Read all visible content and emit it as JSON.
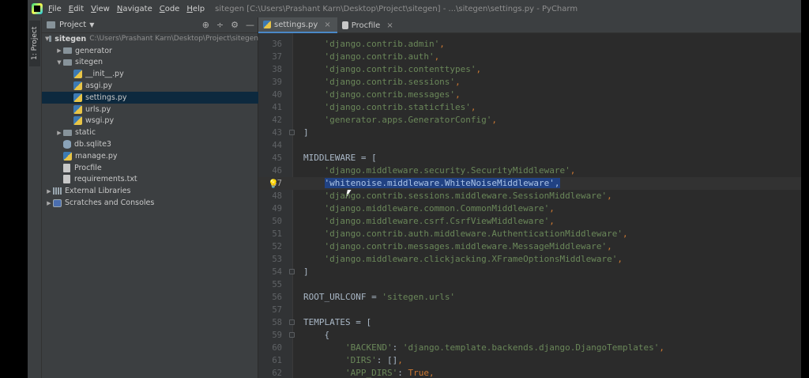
{
  "window_title": "sitegen [C:\\Users\\Prashant Karn\\Desktop\\Project\\sitegen] - ...\\sitegen\\settings.py - PyCharm",
  "menu": [
    {
      "pre": "",
      "u": "F",
      "post": "ile"
    },
    {
      "pre": "",
      "u": "E",
      "post": "dit"
    },
    {
      "pre": "",
      "u": "V",
      "post": "iew"
    },
    {
      "pre": "",
      "u": "N",
      "post": "avigate"
    },
    {
      "pre": "",
      "u": "C",
      "post": "ode"
    },
    {
      "pre": "",
      "u": "H",
      "post": "elp"
    }
  ],
  "tool_stripe": {
    "project_tab": "1: Project"
  },
  "project_panel": {
    "title": "Project",
    "tools": [
      "⊕",
      "÷",
      "⚙",
      "—"
    ]
  },
  "tree": [
    {
      "indent": 0,
      "arrow": "▼",
      "icon": "folder",
      "label": "sitegen",
      "bold": true,
      "path": "C:\\Users\\Prashant Karn\\Desktop\\Project\\sitegen"
    },
    {
      "indent": 1,
      "arrow": "▶",
      "icon": "folder",
      "label": "generator"
    },
    {
      "indent": 1,
      "arrow": "▼",
      "icon": "folder",
      "label": "sitegen"
    },
    {
      "indent": 2,
      "arrow": "",
      "icon": "py",
      "label": "__init__.py"
    },
    {
      "indent": 2,
      "arrow": "",
      "icon": "py",
      "label": "asgi.py"
    },
    {
      "indent": 2,
      "arrow": "",
      "icon": "py",
      "label": "settings.py",
      "selected": true
    },
    {
      "indent": 2,
      "arrow": "",
      "icon": "py",
      "label": "urls.py"
    },
    {
      "indent": 2,
      "arrow": "",
      "icon": "py",
      "label": "wsgi.py"
    },
    {
      "indent": 1,
      "arrow": "▶",
      "icon": "folder",
      "label": "static"
    },
    {
      "indent": 1,
      "arrow": "",
      "icon": "db",
      "label": "db.sqlite3"
    },
    {
      "indent": 1,
      "arrow": "",
      "icon": "py",
      "label": "manage.py"
    },
    {
      "indent": 1,
      "arrow": "",
      "icon": "file",
      "label": "Procfile"
    },
    {
      "indent": 1,
      "arrow": "",
      "icon": "file",
      "label": "requirements.txt"
    },
    {
      "indent": 0,
      "arrow": "▶",
      "icon": "lib",
      "label": "External Libraries"
    },
    {
      "indent": 0,
      "arrow": "▶",
      "icon": "scratch",
      "label": "Scratches and Consoles"
    }
  ],
  "tabs": [
    {
      "label": "settings.py",
      "icon": "py",
      "active": true
    },
    {
      "label": "Procfile",
      "icon": "file",
      "active": false
    }
  ],
  "code_lines": [
    {
      "n": "36",
      "t": [
        [
          "s-str",
          "    'django.contrib.admin'"
        ],
        [
          "s-kw",
          ","
        ]
      ]
    },
    {
      "n": "37",
      "t": [
        [
          "s-str",
          "    'django.contrib.auth'"
        ],
        [
          "s-kw",
          ","
        ]
      ]
    },
    {
      "n": "38",
      "t": [
        [
          "s-str",
          "    'django.contrib.contenttypes'"
        ],
        [
          "s-kw",
          ","
        ]
      ]
    },
    {
      "n": "39",
      "t": [
        [
          "s-str",
          "    'django.contrib.sessions'"
        ],
        [
          "s-kw",
          ","
        ]
      ]
    },
    {
      "n": "40",
      "t": [
        [
          "s-str",
          "    'django.contrib.messages'"
        ],
        [
          "s-kw",
          ","
        ]
      ]
    },
    {
      "n": "41",
      "t": [
        [
          "s-str",
          "    'django.contrib.staticfiles'"
        ],
        [
          "s-kw",
          ","
        ]
      ]
    },
    {
      "n": "42",
      "t": [
        [
          "s-str",
          "    'generator.apps.GeneratorConfig'"
        ],
        [
          "s-kw",
          ","
        ]
      ]
    },
    {
      "n": "43",
      "t": [
        [
          "s-id",
          "]"
        ]
      ],
      "fold": true
    },
    {
      "n": "44",
      "t": []
    },
    {
      "n": "45",
      "t": [
        [
          "s-id",
          "MIDDLEWARE = ["
        ]
      ]
    },
    {
      "n": "46",
      "t": [
        [
          "s-str",
          "    'django.middleware.security.SecurityMiddleware'"
        ],
        [
          "s-kw",
          ","
        ]
      ]
    },
    {
      "n": "47",
      "t": [
        [
          "s-id",
          "    "
        ],
        [
          "s-sel",
          "'whitenoise.middleware.WhiteNoiseMiddleware',"
        ]
      ],
      "current": true,
      "bulb": true
    },
    {
      "n": "48",
      "t": [
        [
          "s-str",
          "    'django.contrib.sessions.middleware.SessionMiddleware'"
        ],
        [
          "s-kw",
          ","
        ]
      ]
    },
    {
      "n": "49",
      "t": [
        [
          "s-str",
          "    'django.middleware.common.CommonMiddleware'"
        ],
        [
          "s-kw",
          ","
        ]
      ]
    },
    {
      "n": "50",
      "t": [
        [
          "s-str",
          "    'django.middleware.csrf.CsrfViewMiddleware'"
        ],
        [
          "s-kw",
          ","
        ]
      ]
    },
    {
      "n": "51",
      "t": [
        [
          "s-str",
          "    'django.contrib.auth.middleware.AuthenticationMiddleware'"
        ],
        [
          "s-kw",
          ","
        ]
      ]
    },
    {
      "n": "52",
      "t": [
        [
          "s-str",
          "    'django.contrib.messages.middleware.MessageMiddleware'"
        ],
        [
          "s-kw",
          ","
        ]
      ]
    },
    {
      "n": "53",
      "t": [
        [
          "s-str",
          "    'django.middleware.clickjacking.XFrameOptionsMiddleware'"
        ],
        [
          "s-kw",
          ","
        ]
      ]
    },
    {
      "n": "54",
      "t": [
        [
          "s-id",
          "]"
        ]
      ],
      "fold": true
    },
    {
      "n": "55",
      "t": []
    },
    {
      "n": "56",
      "t": [
        [
          "s-id",
          "ROOT_URLCONF = "
        ],
        [
          "s-str",
          "'sitegen.urls'"
        ]
      ]
    },
    {
      "n": "57",
      "t": []
    },
    {
      "n": "58",
      "t": [
        [
          "s-id",
          "TEMPLATES = ["
        ]
      ],
      "fold": true
    },
    {
      "n": "59",
      "t": [
        [
          "s-id",
          "    {"
        ]
      ],
      "fold": true
    },
    {
      "n": "60",
      "t": [
        [
          "s-str",
          "        'BACKEND'"
        ],
        [
          "s-id",
          ": "
        ],
        [
          "s-str",
          "'django.template.backends.django.DjangoTemplates'"
        ],
        [
          "s-kw",
          ","
        ]
      ]
    },
    {
      "n": "61",
      "t": [
        [
          "s-str",
          "        'DIRS'"
        ],
        [
          "s-id",
          ": []"
        ],
        [
          "s-kw",
          ","
        ]
      ]
    },
    {
      "n": "62",
      "t": [
        [
          "s-str",
          "        'APP_DIRS'"
        ],
        [
          "s-id",
          ": "
        ],
        [
          "s-kw",
          "True,"
        ]
      ]
    }
  ]
}
